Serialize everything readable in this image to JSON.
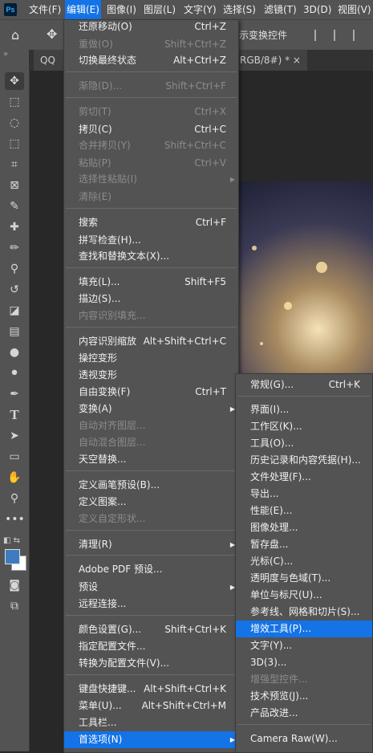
{
  "app": {
    "logo": "Ps"
  },
  "menubar": [
    "文件(F)",
    "编辑(E)",
    "图像(I)",
    "图层(L)",
    "文字(Y)",
    "选择(S)",
    "滤镜(T)",
    "3D(D)",
    "视图(V)"
  ],
  "options": {
    "transform_label": "示变换控件"
  },
  "tabs": {
    "tab1": "QQ图",
    "tab2": "RGB/8#) * ×"
  },
  "edit_menu": [
    {
      "label": "还原移动(O)",
      "shortcut": "Ctrl+Z"
    },
    {
      "label": "重做(O)",
      "shortcut": "Shift+Ctrl+Z",
      "disabled": true
    },
    {
      "label": "切换最终状态",
      "shortcut": "Alt+Ctrl+Z"
    },
    {
      "label": "渐隐(D)...",
      "shortcut": "Shift+Ctrl+F",
      "disabled": true
    },
    {
      "label": "剪切(T)",
      "shortcut": "Ctrl+X",
      "disabled": true
    },
    {
      "label": "拷贝(C)",
      "shortcut": "Ctrl+C"
    },
    {
      "label": "合并拷贝(Y)",
      "shortcut": "Shift+Ctrl+C",
      "disabled": true
    },
    {
      "label": "粘贴(P)",
      "shortcut": "Ctrl+V",
      "disabled": true
    },
    {
      "label": "选择性粘贴(I)",
      "shortcut": "",
      "disabled": true,
      "submenu": true
    },
    {
      "label": "清除(E)",
      "shortcut": "",
      "disabled": true
    },
    {
      "label": "搜索",
      "shortcut": "Ctrl+F"
    },
    {
      "label": "拼写检查(H)...",
      "shortcut": ""
    },
    {
      "label": "查找和替换文本(X)...",
      "shortcut": ""
    },
    {
      "label": "填充(L)...",
      "shortcut": "Shift+F5"
    },
    {
      "label": "描边(S)...",
      "shortcut": ""
    },
    {
      "label": "内容识别填充...",
      "shortcut": "",
      "disabled": true
    },
    {
      "label": "内容识别缩放",
      "shortcut": "Alt+Shift+Ctrl+C"
    },
    {
      "label": "操控变形",
      "shortcut": ""
    },
    {
      "label": "透视变形",
      "shortcut": ""
    },
    {
      "label": "自由变换(F)",
      "shortcut": "Ctrl+T"
    },
    {
      "label": "变换(A)",
      "shortcut": "",
      "submenu": true
    },
    {
      "label": "自动对齐图层...",
      "shortcut": "",
      "disabled": true
    },
    {
      "label": "自动混合图层...",
      "shortcut": "",
      "disabled": true
    },
    {
      "label": "天空替换...",
      "shortcut": ""
    },
    {
      "label": "定义画笔预设(B)...",
      "shortcut": ""
    },
    {
      "label": "定义图案...",
      "shortcut": ""
    },
    {
      "label": "定义自定形状...",
      "shortcut": "",
      "disabled": true
    },
    {
      "label": "清理(R)",
      "shortcut": "",
      "submenu": true
    },
    {
      "label": "Adobe PDF 预设...",
      "shortcut": ""
    },
    {
      "label": "预设",
      "shortcut": "",
      "submenu": true
    },
    {
      "label": "远程连接...",
      "shortcut": ""
    },
    {
      "label": "颜色设置(G)...",
      "shortcut": "Shift+Ctrl+K"
    },
    {
      "label": "指定配置文件...",
      "shortcut": ""
    },
    {
      "label": "转换为配置文件(V)...",
      "shortcut": ""
    },
    {
      "label": "键盘快捷键...",
      "shortcut": "Alt+Shift+Ctrl+K"
    },
    {
      "label": "菜单(U)...",
      "shortcut": "Alt+Shift+Ctrl+M"
    },
    {
      "label": "工具栏...",
      "shortcut": ""
    },
    {
      "label": "首选项(N)",
      "shortcut": "",
      "submenu": true,
      "highlight": true
    }
  ],
  "pref_menu": [
    {
      "label": "常规(G)...",
      "shortcut": "Ctrl+K"
    },
    {
      "label": "界面(I)...",
      "shortcut": ""
    },
    {
      "label": "工作区(K)...",
      "shortcut": ""
    },
    {
      "label": "工具(O)...",
      "shortcut": ""
    },
    {
      "label": "历史记录和内容凭据(H)...",
      "shortcut": ""
    },
    {
      "label": "文件处理(F)...",
      "shortcut": ""
    },
    {
      "label": "导出...",
      "shortcut": ""
    },
    {
      "label": "性能(E)...",
      "shortcut": ""
    },
    {
      "label": "图像处理...",
      "shortcut": ""
    },
    {
      "label": "暂存盘...",
      "shortcut": ""
    },
    {
      "label": "光标(C)...",
      "shortcut": ""
    },
    {
      "label": "透明度与色域(T)...",
      "shortcut": ""
    },
    {
      "label": "单位与标尺(U)...",
      "shortcut": ""
    },
    {
      "label": "参考线、网格和切片(S)...",
      "shortcut": ""
    },
    {
      "label": "增效工具(P)...",
      "shortcut": "",
      "highlight": true
    },
    {
      "label": "文字(Y)...",
      "shortcut": ""
    },
    {
      "label": "3D(3)...",
      "shortcut": ""
    },
    {
      "label": "增强型控件...",
      "shortcut": "",
      "disabled": true
    },
    {
      "label": "技术预览(J)...",
      "shortcut": ""
    },
    {
      "label": "产品改进...",
      "shortcut": ""
    },
    {
      "label": "Camera Raw(W)...",
      "shortcut": ""
    }
  ],
  "tools": [
    "move-icon",
    "marquee-icon",
    "lasso-icon",
    "object-select-icon",
    "crop-icon",
    "frame-icon",
    "eyedropper-icon",
    "healing-brush-icon",
    "brush-icon",
    "stamp-icon",
    "history-brush-icon",
    "eraser-icon",
    "gradient-icon",
    "blur-icon",
    "dodge-icon",
    "pen-icon",
    "type-icon",
    "path-select-icon",
    "rectangle-icon",
    "hand-icon",
    "zoom-icon",
    "more-icon"
  ],
  "colors": {
    "highlight": "#1473e6",
    "foreground": "#3d7cc0",
    "background": "#ffffff"
  }
}
